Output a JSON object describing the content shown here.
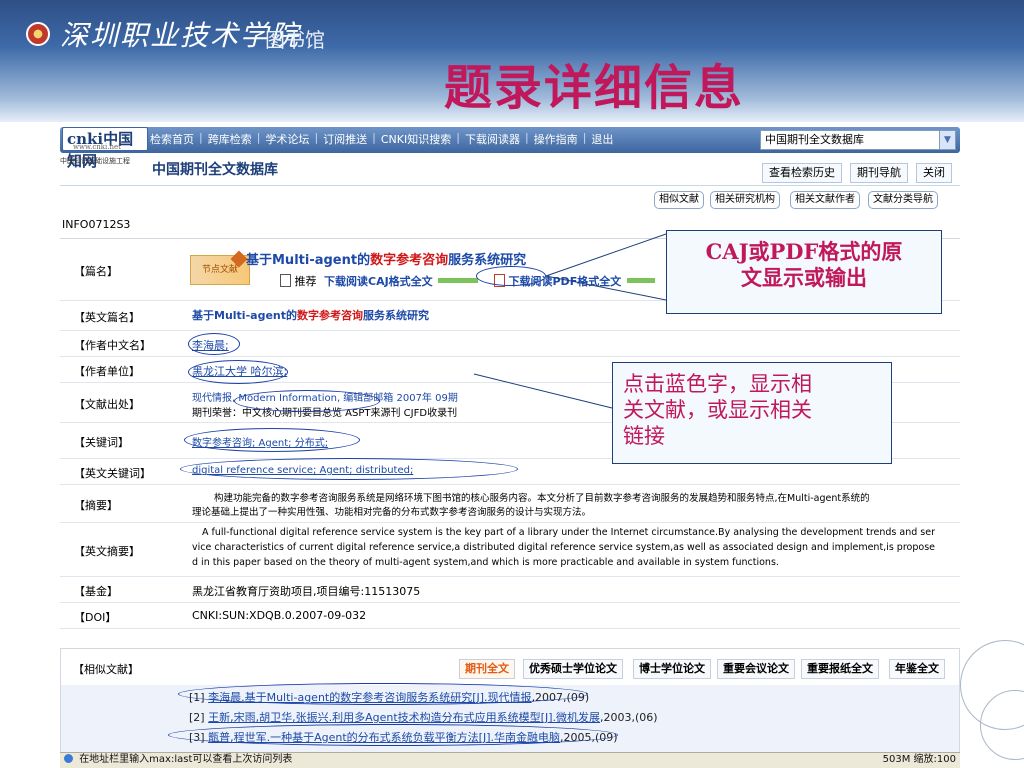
{
  "slide": {
    "school_name": "深圳职业技术学院",
    "school_suffix": "图书馆",
    "title": "题录详细信息"
  },
  "cnki": {
    "logo": "cnki中国知网",
    "logo_url": "www.cnki.net",
    "logo_sub": "中国知识基础设施工程",
    "nav": [
      "检索首页",
      "跨库检索",
      "学术论坛",
      "订阅推送",
      "CNKI知识搜索",
      "下载阅读器",
      "操作指南",
      "退出"
    ],
    "db_select": "中国期刊全文数据库",
    "db_title": "中国期刊全文数据库",
    "toolbar": [
      "查看检索历史",
      "期刊导航",
      "关闭"
    ],
    "pills": [
      "相似文献",
      "相关研究机构",
      "相关文献作者",
      "文献分类导航"
    ],
    "info_code": "INFO0712S3"
  },
  "record": {
    "label_title": "【篇名】",
    "banner": "节点文献",
    "title_a": "基于Multi-agent的",
    "title_b": "数字参考咨询",
    "title_c": "服务系统研究",
    "recommend": "推荐",
    "caj_link": "下载阅读CAJ格式全文",
    "pdf_link": "下载阅读PDF格式全文",
    "label_en_title": "【英文篇名】",
    "label_author": "【作者中文名】",
    "author": "李海晨;",
    "label_org": "【作者单位】",
    "org": "黑龙江大学 哈尔滨;",
    "label_source": "【文献出处】",
    "source_line1": "现代情报, Modern Information, 编辑部邮箱 2007年 09期",
    "source_line2": "期刊荣誉：中文核心期刊要目总览 ASPT来源刊 CJFD收录刊",
    "label_keywords": "【关键词】",
    "keywords": "数字参考咨询; Agent; 分布式;",
    "label_en_keywords": "【英文关键词】",
    "en_keywords": "digital reference service; Agent; distributed;",
    "label_abstract": "【摘要】",
    "abstract_line1": "构建功能完备的数字参考咨询服务系统是网络环境下图书馆的核心服务内容。本文分析了目前数字参考咨询服务的发展趋势和服务特点,在Multi-agent系统的",
    "abstract_line2": "理论基础上提出了一种实用性强、功能相对完备的分布式数字参考咨询服务的设计与实现方法。",
    "label_en_abstract": "【英文摘要】",
    "en_abstract_line1": "A full-functional digital reference service system is the key part of a library under the Internet circumstance.By analysing the development trends and ser",
    "en_abstract_line2": "vice characteristics of current digital reference service,a distributed digital reference service system,as well as associated design and implement,is propose",
    "en_abstract_line3": "d in this paper based on the theory of multi-agent system,and which is more practicable and available in system functions.",
    "label_fund": "【基金】",
    "fund": "黑龙江省教育厅资助项目,项目编号:11513075",
    "label_doi": "【DOI】",
    "doi": "CNKI:SUN:XDQB.0.2007-09-032"
  },
  "annotations": {
    "box1_line1": "CAJ或PDF格式的原",
    "box1_line2": "文显示或输出",
    "box2_line1": "点击蓝色字，显示相",
    "box2_line2": "关文献，或显示相关",
    "box2_line3": "链接"
  },
  "related": {
    "label": "【相似文献】",
    "tabs": [
      "期刊全文",
      "优秀硕士学位论文",
      "博士学位论文",
      "重要会议论文",
      "重要报纸全文",
      "年鉴全文"
    ],
    "refs": [
      {
        "num": "[1]",
        "authors": "李海晨.",
        "title": "基于Multi-agent的数字参考咨询服务系统研究[J].",
        "journal": "现代情报",
        "year": ",2007,(09)"
      },
      {
        "num": "[2]",
        "authors": "王新,宋雨,胡卫华,张振兴.",
        "title": "利用多Agent技术构造分布式应用系统模型[J].",
        "journal": "微机发展",
        "year": ",2003,(06)"
      },
      {
        "num": "[3]",
        "authors": "甑普,程世军.",
        "title": "一种基于Agent的分布式系统负载平衡方法[J].",
        "journal": "华南金融电脑",
        "year": ",2005,(09)"
      }
    ]
  },
  "status": {
    "left": "在地址栏里输入max:last可以查看上次访问列表",
    "right": "503M 缩放:100"
  }
}
